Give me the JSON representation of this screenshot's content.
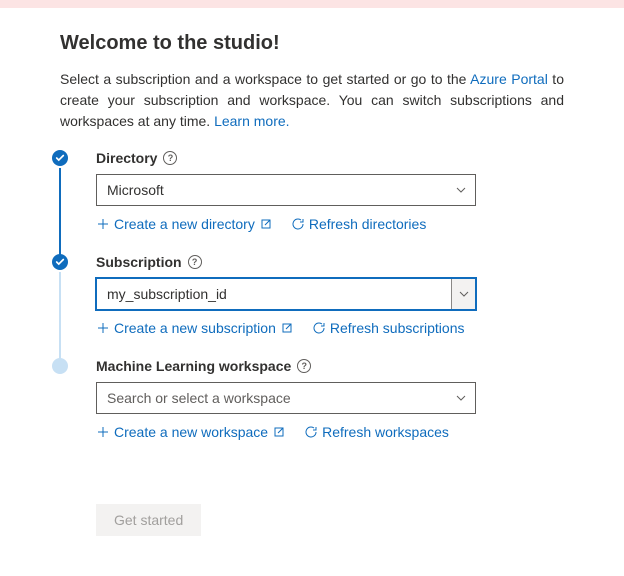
{
  "header": {
    "title": "Welcome to the studio!"
  },
  "intro": {
    "text1": "Select a subscription and a workspace to get started or go to the ",
    "link1": "Azure Portal",
    "text2": " to create your subscription and workspace. You can switch subscriptions and workspaces at any time. ",
    "link2": "Learn more."
  },
  "steps": {
    "directory": {
      "label": "Directory",
      "value": "Microsoft",
      "create_label": "Create a new directory",
      "refresh_label": "Refresh directories"
    },
    "subscription": {
      "label": "Subscription",
      "value": "my_subscription_id",
      "create_label": "Create a new subscription",
      "refresh_label": "Refresh subscriptions"
    },
    "workspace": {
      "label": "Machine Learning workspace",
      "placeholder": "Search or select a workspace",
      "create_label": "Create a new workspace",
      "refresh_label": "Refresh workspaces"
    }
  },
  "button": {
    "get_started": "Get started"
  }
}
